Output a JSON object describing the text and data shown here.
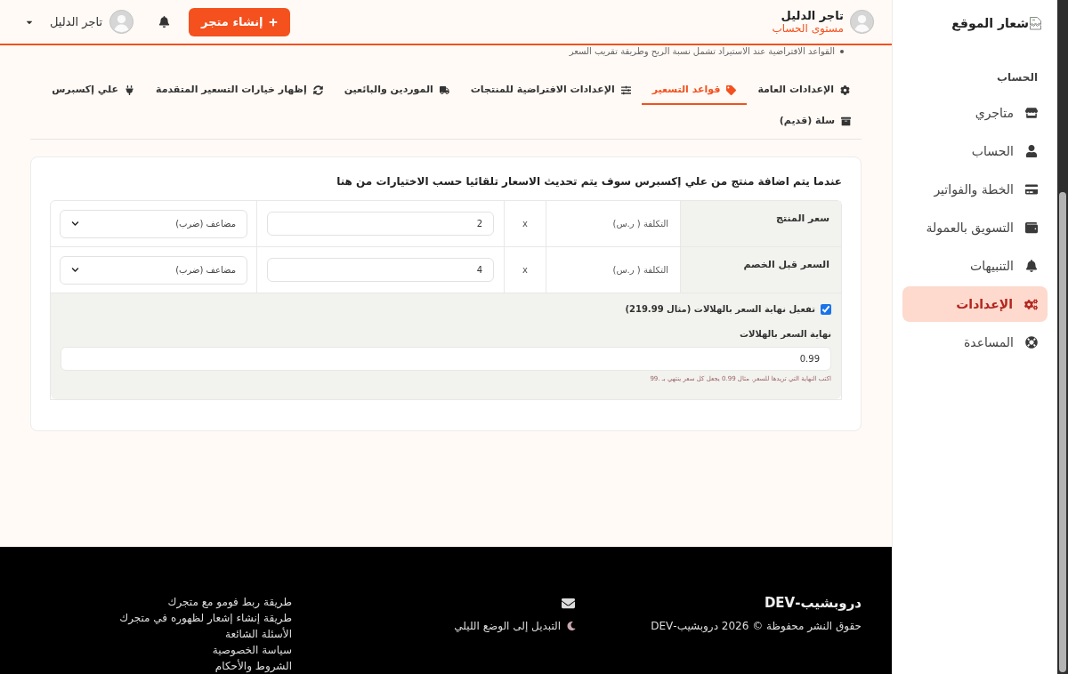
{
  "header": {
    "account": {
      "name": "تاجر الدليل",
      "level_label": "مستوى الحساب"
    },
    "create_store_button": "إنشاء متجر",
    "user_menu": {
      "name": "تاجر الدليل"
    }
  },
  "sidebar": {
    "logo_alt": "شعار الموقع",
    "section_title": "الحساب",
    "items": [
      {
        "label": "متاجري",
        "selected": false
      },
      {
        "label": "الحساب",
        "selected": false
      },
      {
        "label": "الخطة والفواتير",
        "selected": false
      },
      {
        "label": "التسويق بالعمولة",
        "selected": false
      },
      {
        "label": "التنبيهات",
        "selected": false
      },
      {
        "label": "الإعدادات",
        "selected": true
      },
      {
        "label": "المساعدة",
        "selected": false
      }
    ]
  },
  "notice": "القواعد الافتراضية عند الاستيراد تشمل نسبة الربح وطريقة تقريب السعر",
  "tabs": [
    {
      "label": "الإعدادات العامة",
      "selected": false
    },
    {
      "label": "قواعد التسعير",
      "selected": true
    },
    {
      "label": "الإعدادات الافتراضية للمنتجات",
      "selected": false
    },
    {
      "label": "الموردين والبائعين",
      "selected": false
    },
    {
      "label": "إظهار خيارات التسعير المتقدمة",
      "selected": false
    },
    {
      "label": "علي إكسبرس",
      "selected": false
    },
    {
      "label": "سلة (قديم)",
      "selected": false
    }
  ],
  "pricing_card": {
    "heading": "عندما يتم اضافة منتج من علي إكسبرس سوف يتم تحديث الاسعار تلقائيا حسب الاختيارات من هنا",
    "rules": [
      {
        "label": "سعر المنتج",
        "base": "التكلفة ( ر.س)",
        "operator": "x",
        "value": "2",
        "method": "مضاعف (ضرب)"
      },
      {
        "label": "السعر قبل الخصم",
        "base": "التكلفة ( ر.س)",
        "operator": "x",
        "value": "4",
        "method": "مضاعف (ضرب)"
      }
    ],
    "cents_toggle": {
      "label": "تفعيل نهاية السعر بالهلالات (مثال 219.99)",
      "checked": true
    },
    "cents_field": {
      "label": "نهاية السعر بالهلالات",
      "value": "0.99",
      "hint": "اكتب النهاية التي تريدها للسعر. مثال 0.99 يجعل كل سعر ينتهي بـ .99"
    }
  },
  "footer": {
    "brand": "دروبشيب-DEV",
    "copyright": "حقوق النشر محفوظة © 2026 دروبشيب-DEV",
    "dark_mode_toggle": "التبديل إلى الوضع الليلي",
    "links": [
      "طريقة ربط فومو مع متجرك",
      "طريقة إنشاء إشعار لظهوره في متجرك",
      "الأسئلة الشائعة",
      "سياسة الخصوصية",
      "الشروط والأحكام"
    ]
  }
}
